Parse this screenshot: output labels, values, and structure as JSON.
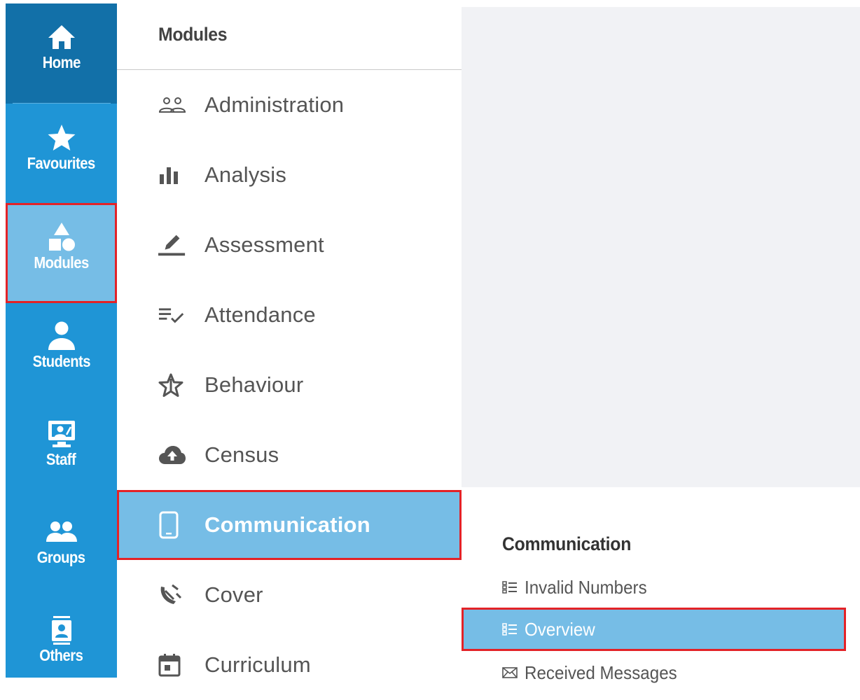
{
  "rail": {
    "items": [
      {
        "label": "Home",
        "icon": "home-icon"
      },
      {
        "label": "Favourites",
        "icon": "star-icon"
      },
      {
        "label": "Modules",
        "icon": "shapes-icon"
      },
      {
        "label": "Students",
        "icon": "person-icon"
      },
      {
        "label": "Staff",
        "icon": "presentation-icon"
      },
      {
        "label": "Groups",
        "icon": "group-icon"
      },
      {
        "label": "Others",
        "icon": "contact-card-icon"
      }
    ],
    "active": "Modules"
  },
  "modules": {
    "title": "Modules",
    "items": [
      {
        "label": "Administration",
        "icon": "people-outline-icon"
      },
      {
        "label": "Analysis",
        "icon": "bar-chart-icon"
      },
      {
        "label": "Assessment",
        "icon": "pencil-icon"
      },
      {
        "label": "Attendance",
        "icon": "checklist-icon"
      },
      {
        "label": "Behaviour",
        "icon": "star-outline-icon"
      },
      {
        "label": "Census",
        "icon": "cloud-upload-icon"
      },
      {
        "label": "Communication",
        "icon": "phone-icon"
      },
      {
        "label": "Cover",
        "icon": "satellite-dish-icon"
      },
      {
        "label": "Curriculum",
        "icon": "calendar-icon"
      }
    ],
    "active": "Communication"
  },
  "submenu": {
    "title": "Communication",
    "items": [
      {
        "label": "Invalid Numbers",
        "icon": "list-icon"
      },
      {
        "label": "Overview",
        "icon": "list-icon"
      },
      {
        "label": "Received Messages",
        "icon": "envelope-icon"
      }
    ],
    "active": "Overview"
  },
  "colors": {
    "rail": "#1f95d6",
    "rail_home": "#1270a8",
    "active_blue": "#76bde6",
    "highlight_red": "#e32227",
    "content_grey": "#f1f2f5"
  }
}
